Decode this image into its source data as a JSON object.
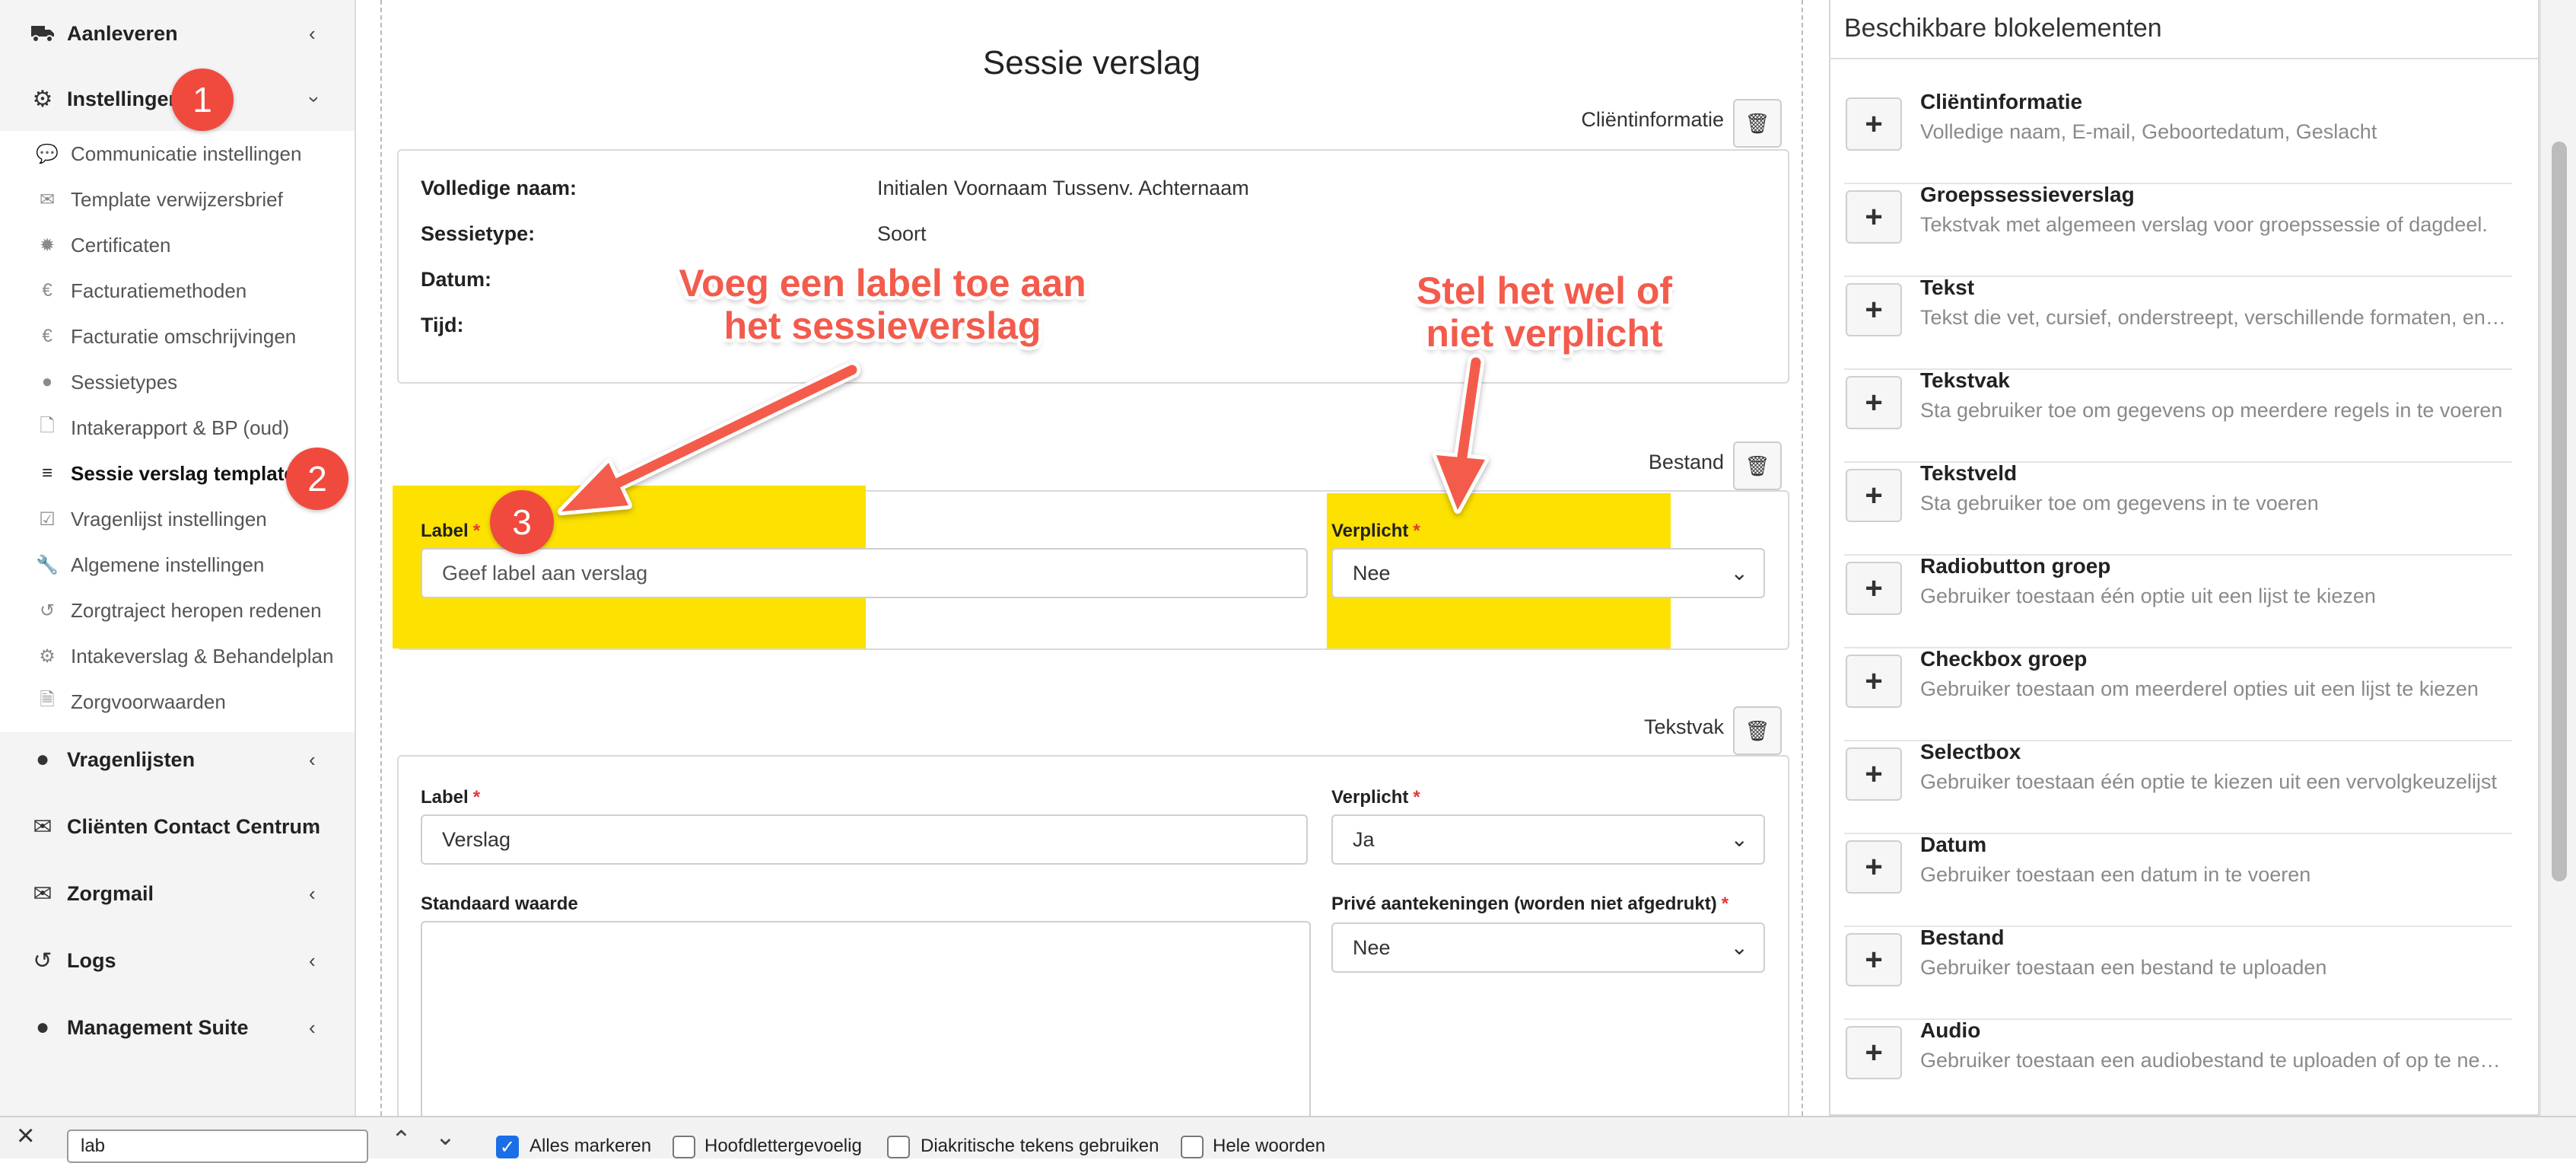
{
  "sidebar": {
    "sections_top": [
      {
        "label": "Aanleveren",
        "icon": "truck-icon",
        "state": "collapsed"
      },
      {
        "label": "Instellingen",
        "icon": "gear-icon",
        "state": "expanded"
      }
    ],
    "sub_items": [
      {
        "label": "Communicatie instellingen",
        "icon": "chat-bubbles-icon"
      },
      {
        "label": "Template verwijzersbrief",
        "icon": "envelope-icon"
      },
      {
        "label": "Certificaten",
        "icon": "certificate-icon"
      },
      {
        "label": "Facturatiemethoden",
        "icon": "euro-icon"
      },
      {
        "label": "Facturatie omschrijvingen",
        "icon": "euro-icon"
      },
      {
        "label": "Sessietypes",
        "icon": "globe-icon"
      },
      {
        "label": "Intakerapport & BP (oud)",
        "icon": "document-icon"
      },
      {
        "label": "Sessie verslag template",
        "icon": "database-icon"
      },
      {
        "label": "Vragenlijst instellingen",
        "icon": "checklist-icon"
      },
      {
        "label": "Algemene instellingen",
        "icon": "wrench-icon"
      },
      {
        "label": "Zorgtraject heropen redenen",
        "icon": "undo-icon"
      },
      {
        "label": "Intakeverslag & Behandelplan",
        "icon": "gear-icon"
      },
      {
        "label": "Zorgvoorwaarden",
        "icon": "pdf-icon"
      }
    ],
    "sections_bottom": [
      {
        "label": "Vragenlijsten",
        "icon": "globe-icon"
      },
      {
        "label": "Cliënten Contact Centrum",
        "icon": "envelope-icon"
      },
      {
        "label": "Zorgmail",
        "icon": "envelope-icon"
      },
      {
        "label": "Logs",
        "icon": "history-icon"
      },
      {
        "label": "Management Suite",
        "icon": "globe-icon"
      }
    ]
  },
  "badges": {
    "one": "1",
    "two": "2",
    "three": "3"
  },
  "main": {
    "title": "Sessie verslag",
    "client_block": {
      "caption": "Cliëntinformatie",
      "rows": [
        {
          "label": "Volledige naam:",
          "value": "Initialen Voornaam Tussenv. Achternaam"
        },
        {
          "label": "Sessietype:",
          "value": "Soort"
        },
        {
          "label": "Datum:",
          "value": ""
        },
        {
          "label": "Tijd:",
          "value": ""
        }
      ]
    },
    "bestand_block": {
      "caption": "Bestand",
      "label_field": {
        "label": "Label",
        "placeholder": "Geef label aan verslag"
      },
      "required_field": {
        "label": "Verplicht",
        "value": "Nee"
      }
    },
    "tekstvak_block": {
      "caption": "Tekstvak",
      "label_field": {
        "label": "Label",
        "value": "Verslag"
      },
      "required_field": {
        "label": "Verplicht",
        "value": "Ja"
      },
      "default_field": {
        "label": "Standaard waarde",
        "value": ""
      },
      "private_field": {
        "label": "Privé aantekeningen (worden niet afgedrukt)",
        "value": "Nee"
      }
    },
    "required_marker": "*"
  },
  "annotations": {
    "left": [
      "Voeg een label toe aan",
      "het sessieverslag"
    ],
    "right": [
      "Stel het wel of",
      "niet verplicht"
    ]
  },
  "right_panel": {
    "title": "Beschikbare blokelementen",
    "add_glyph": "+",
    "items": [
      {
        "title": "Cliëntinformatie",
        "desc": "Volledige naam, E-mail, Geboortedatum, Geslacht"
      },
      {
        "title": "Groepssessieverslag",
        "desc": "Tekstvak met algemeen verslag voor groepssessie of dagdeel."
      },
      {
        "title": "Tekst",
        "desc": "Tekst die vet, cursief, onderstreept, verschillende formaten, enz. …"
      },
      {
        "title": "Tekstvak",
        "desc": "Sta gebruiker toe om gegevens op meerdere regels in te voeren"
      },
      {
        "title": "Tekstveld",
        "desc": "Sta gebruiker toe om gegevens in te voeren"
      },
      {
        "title": "Radiobutton groep",
        "desc": "Gebruiker toestaan één optie uit een lijst te kiezen"
      },
      {
        "title": "Checkbox groep",
        "desc": "Gebruiker toestaan om meerderel opties uit een lijst te kiezen"
      },
      {
        "title": "Selectbox",
        "desc": "Gebruiker toestaan één optie te kiezen uit een vervolgkeuzelijst"
      },
      {
        "title": "Datum",
        "desc": "Gebruiker toestaan een datum in te voeren"
      },
      {
        "title": "Bestand",
        "desc": "Gebruiker toestaan een bestand te uploaden"
      },
      {
        "title": "Audio",
        "desc": "Gebruiker toestaan een audiobestand te uploaden of op te nemen"
      }
    ]
  },
  "findbar": {
    "query": "lab",
    "options": [
      {
        "label": "Alles markeren",
        "checked": true
      },
      {
        "label": "Hoofdlettergevoelig",
        "checked": false
      },
      {
        "label": "Diakritische tekens gebruiken",
        "checked": false
      },
      {
        "label": "Hele woorden",
        "checked": false
      }
    ]
  },
  "colors": {
    "accent": "#1a6fe6",
    "annotation": "#f35b4c",
    "badge": "#f04a3e",
    "highlight": "#fde100",
    "required": "#e53935"
  }
}
